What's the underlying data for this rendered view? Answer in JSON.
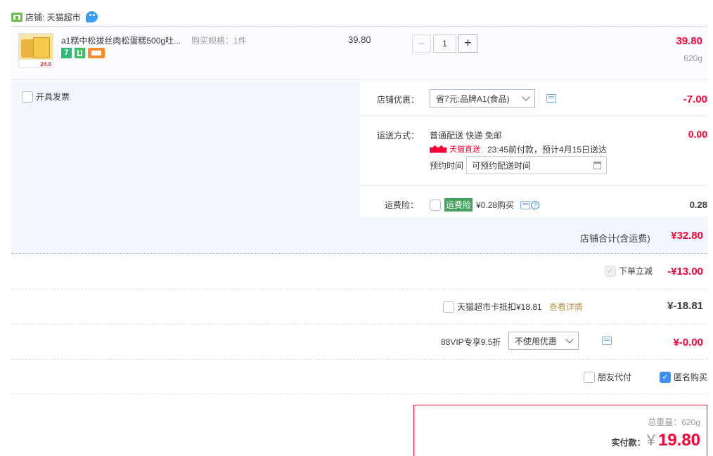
{
  "shop": {
    "label": "店铺: 天猫超市"
  },
  "item": {
    "title": "a1糕中松拔丝肉松蛋糕500g吐...",
    "spec": "购买规格：1件",
    "unit_price": "39.80",
    "quantity": "1",
    "subtotal": "39.80",
    "weight": "620g",
    "thumb_price": "24.8",
    "badge_seven": "7"
  },
  "invoice": {
    "label": "开具发票"
  },
  "shop_discount": {
    "label": "店铺优惠：",
    "selected": "省7元:品牌A1(食品)",
    "amount": "-7.00"
  },
  "shipping": {
    "label": "运送方式：",
    "method": "普通配送 快递 免邮",
    "tmall_direct": "天猫直送",
    "eta": "23:45前付款，预计4月15日送达",
    "appointment_label": "预约时间",
    "appointment_placeholder": "可预约配送时间",
    "amount": "0.00"
  },
  "insurance": {
    "label": "运费险：",
    "tag": "运费险",
    "price_text": "¥0.28购买",
    "amount": "0.28"
  },
  "shop_total": {
    "label": "店铺合计(含运费)",
    "amount": "¥32.80"
  },
  "instant_discount": {
    "label": "下单立减",
    "amount": "-¥13.00"
  },
  "card": {
    "label": "天猫超市卡抵扣¥18.81",
    "link": "查看详情",
    "amount": "¥-18.81"
  },
  "vip": {
    "label": "88VIP专享9.5折",
    "selected": "不使用优惠",
    "amount": "¥-0.00"
  },
  "options": {
    "friend_pay": "朋友代付",
    "anonymous": "匿名购买"
  },
  "summary": {
    "weight_label": "总重量：620g",
    "pay_label": "实付款：",
    "currency": "¥",
    "pay_amount": "19.80"
  },
  "colors": {
    "accent_red": "#ff0036",
    "blue_panel": "#f2f7ff",
    "check_blue": "#3d8ef7",
    "tmall_red": "#ff0036"
  }
}
